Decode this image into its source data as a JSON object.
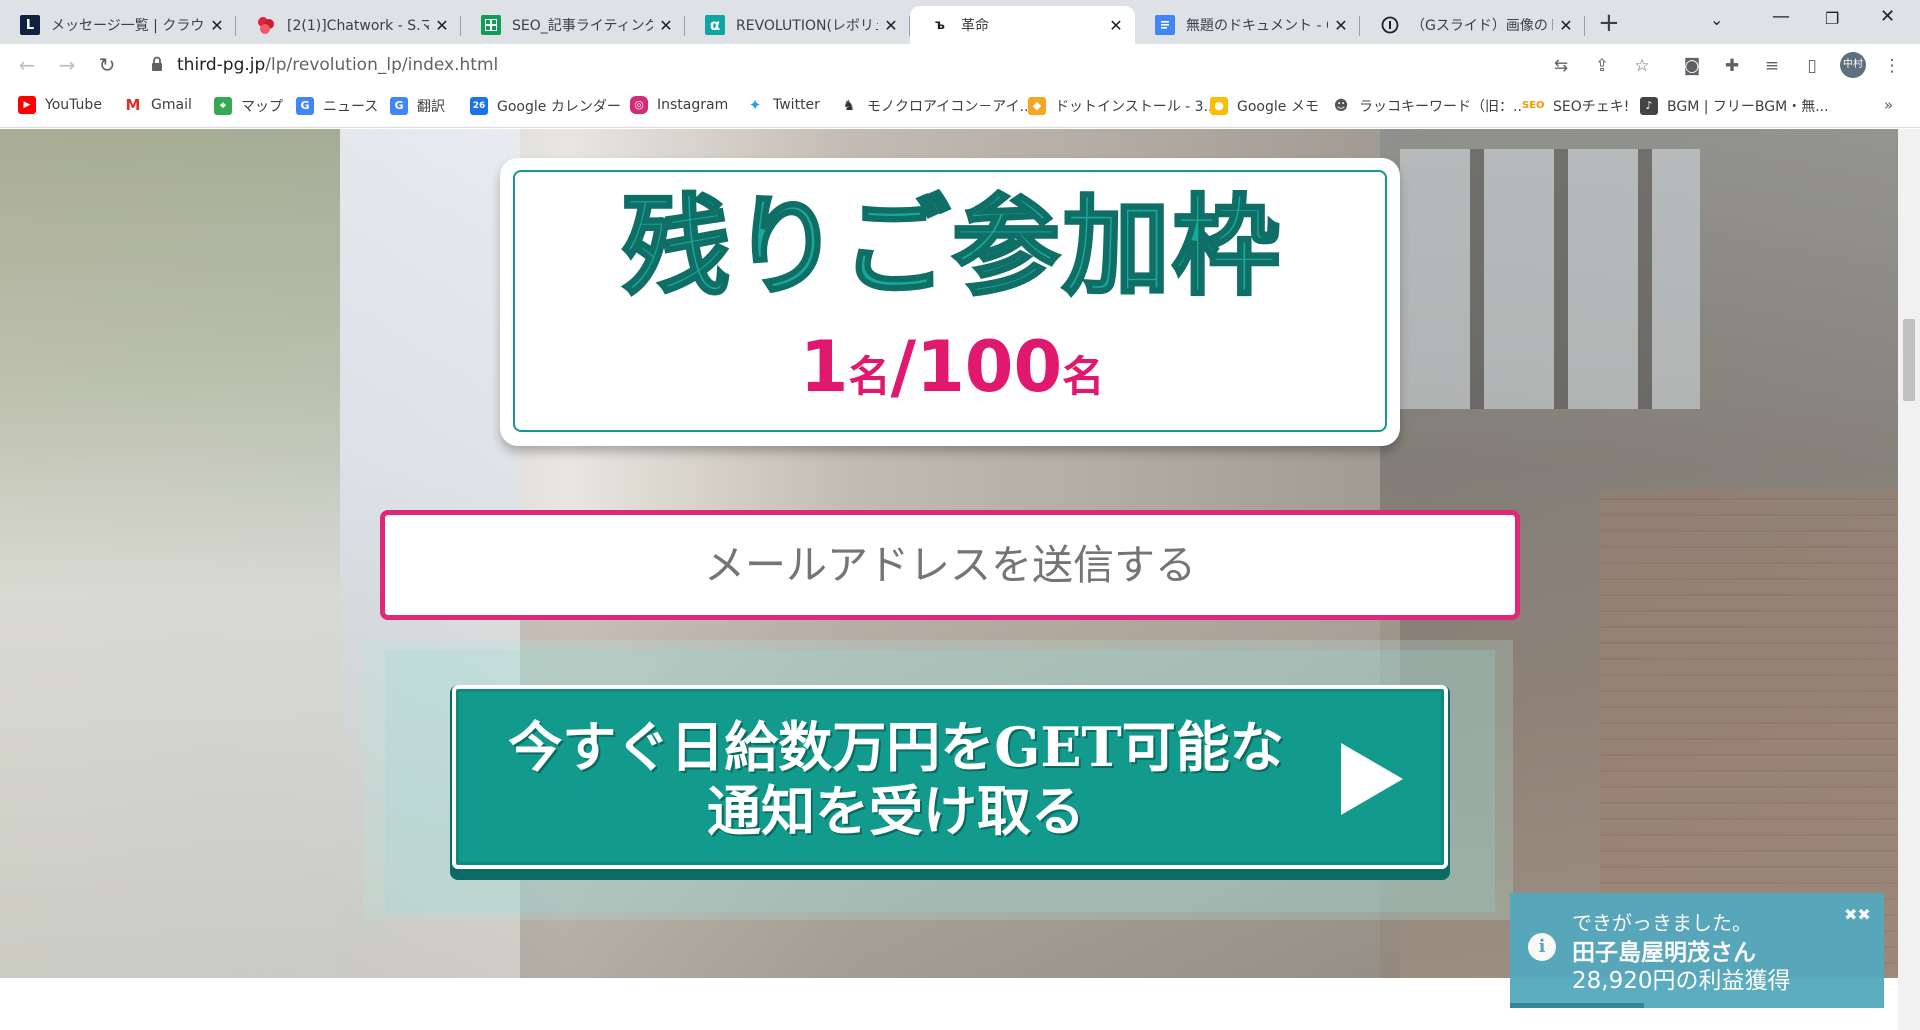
{
  "tabs": [
    {
      "title": "メッセージ一覧 | クラウド",
      "icon": "line-works-icon",
      "icon_letter": "L",
      "color": "#0f2340"
    },
    {
      "title": "[2(1)]Chatwork - S.マダ",
      "icon": "chatwork-icon",
      "color": "#e2233d"
    },
    {
      "title": "SEO_記事ライティング - G",
      "icon": "google-sheets-icon",
      "color": "#0f9d58"
    },
    {
      "title": "REVOLUTION(レボリュー",
      "icon": "revolution-icon",
      "icon_letter": "α",
      "color": "#0ea6a0"
    },
    {
      "title": "革命",
      "icon": "page-icon",
      "icon_letter": "ъ",
      "color": "#ffffff",
      "active": true
    },
    {
      "title": "無題のドキュメント - Goo",
      "icon": "google-docs-icon",
      "color": "#4285f4"
    },
    {
      "title": "（Gスライド）画像のトリ",
      "icon": "info-circle-icon",
      "color": "#ffffff"
    }
  ],
  "toolbar": {
    "url_host": "third-pg.jp",
    "url_path": "/lp/revolution_lp/index.html",
    "avatar_label": "中村"
  },
  "bookmarks": [
    {
      "label": "YouTube",
      "icon": "youtube-icon",
      "color": "#ff0000"
    },
    {
      "label": "Gmail",
      "icon": "gmail-icon",
      "color": "#d93025"
    },
    {
      "label": "マップ",
      "icon": "google-maps-icon",
      "color": "#34a853"
    },
    {
      "label": "ニュース",
      "icon": "google-news-icon",
      "color": "#4285f4"
    },
    {
      "label": "翻訳",
      "icon": "google-translate-icon",
      "color": "#4285f4"
    },
    {
      "label": "Google カレンダー",
      "icon": "google-calendar-icon",
      "color": "#1a73e8"
    },
    {
      "label": "Instagram",
      "icon": "instagram-icon",
      "color": "#d62976"
    },
    {
      "label": "Twitter",
      "icon": "twitter-icon",
      "color": "#1da1f2"
    },
    {
      "label": "モノクロアイコン－アイ...",
      "icon": "owl-icon",
      "color": "#333333"
    },
    {
      "label": "ドットインストール - 3...",
      "icon": "dotinstall-icon",
      "color": "#f5a623"
    },
    {
      "label": "Google メモ",
      "icon": "google-keep-icon",
      "color": "#fbbc04"
    },
    {
      "label": "ラッコキーワード（旧：...",
      "icon": "rakko-icon",
      "color": "#666666"
    },
    {
      "label": "SEOチェキ!",
      "icon": "seo-cheki-icon",
      "color": "#f29b00"
    },
    {
      "label": "BGM | フリーBGM・無...",
      "icon": "bgm-icon",
      "color": "#444444"
    }
  ],
  "lp": {
    "slots_title": "残りご参加枠",
    "slots_remaining": "1",
    "slots_unit1": "名",
    "slots_sep": "/",
    "slots_total": "100",
    "slots_unit2": "名",
    "email_placeholder": "メールアドレスを送信する",
    "cta_line1": "今すぐ日給数万円をGET可能な",
    "cta_line2": "通知を受け取る"
  },
  "toast": {
    "line1": "できがっきました。",
    "line2": "田子島屋明茂さん",
    "line3": "28,920円の利益獲得",
    "close_label": "✖✖",
    "icon_label": "i"
  }
}
